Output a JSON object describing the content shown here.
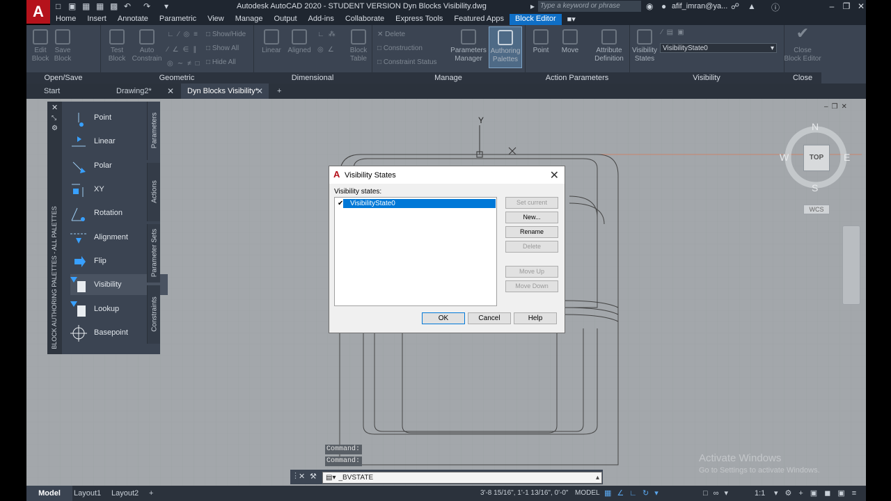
{
  "app": {
    "logo": "A",
    "title": "Autodesk AutoCAD 2020 - STUDENT VERSION    Dyn Blocks Visibility.dwg",
    "search_placeholder": "Type a keyword or phrase",
    "user": "afif_imran@ya..."
  },
  "ribbon_tabs": [
    "Home",
    "Insert",
    "Annotate",
    "Parametric",
    "View",
    "Manage",
    "Output",
    "Add-ins",
    "Collaborate",
    "Express Tools",
    "Featured Apps",
    "Block Editor"
  ],
  "ribbon": {
    "open_save": {
      "title": "Open/Save",
      "edit_block": "Edit\nBlock",
      "save_block": "Save\nBlock"
    },
    "geometric": {
      "title": "Geometric",
      "test_block": "Test\nBlock",
      "auto_constrain": "Auto\nConstrain",
      "show_hide": "Show/Hide",
      "show_all": "Show All",
      "hide_all": "Hide All"
    },
    "dimensional": {
      "title": "Dimensional",
      "linear": "Linear",
      "aligned": "Aligned",
      "block_table": "Block\nTable"
    },
    "manage": {
      "title": "Manage",
      "delete": "Delete",
      "construction": "Construction",
      "constraint_status": "Constraint Status",
      "parameters_manager": "Parameters\nManager",
      "authoring_palettes": "Authoring\nPalettes"
    },
    "action_parameters": {
      "title": "Action Parameters",
      "point": "Point",
      "move": "Move",
      "attribute_definition": "Attribute\nDefinition"
    },
    "visibility": {
      "title": "Visibility",
      "visibility_states": "Visibility\nStates",
      "current_state": "VisibilityState0"
    },
    "close": {
      "title": "Close",
      "close_block_editor": "Close\nBlock Editor"
    }
  },
  "file_tabs": [
    "Start",
    "Drawing2*",
    "Dyn Blocks Visibility*"
  ],
  "palette": {
    "title": "BLOCK AUTHORING PALETTES - ALL PALETTES",
    "items": [
      "Point",
      "Linear",
      "Polar",
      "XY",
      "Rotation",
      "Alignment",
      "Flip",
      "Visibility",
      "Lookup",
      "Basepoint"
    ],
    "side_tabs": [
      "Parameters",
      "Actions",
      "Parameter Sets",
      "Constraints"
    ]
  },
  "dialog": {
    "title": "Visibility States",
    "list_label": "Visibility states:",
    "states": [
      "VisibilityState0"
    ],
    "buttons": {
      "set_current": "Set current",
      "new": "New...",
      "rename": "Rename",
      "delete": "Delete",
      "move_up": "Move Up",
      "move_down": "Move Down"
    },
    "ok": "OK",
    "cancel": "Cancel",
    "help": "Help"
  },
  "viewcube": {
    "n": "N",
    "s": "S",
    "e": "E",
    "w": "W",
    "face": "TOP",
    "wcs": "WCS"
  },
  "axis": {
    "y": "Y"
  },
  "command": {
    "history": [
      "Command:",
      "Command:"
    ],
    "input": "_BVSTATE"
  },
  "watermark": {
    "line1": "Activate Windows",
    "line2": "Go to Settings to activate Windows."
  },
  "status": {
    "tabs": [
      "Model",
      "Layout1",
      "Layout2"
    ],
    "coords": "3'-8 15/16\", 1'-1 13/16\", 0'-0\"",
    "space": "MODEL",
    "scale": "1:1"
  },
  "colors": {
    "accent": "#0f6fc6",
    "ribbon": "#3b4452",
    "canvas": "#a3a7ab",
    "logo": "#b5121b"
  }
}
